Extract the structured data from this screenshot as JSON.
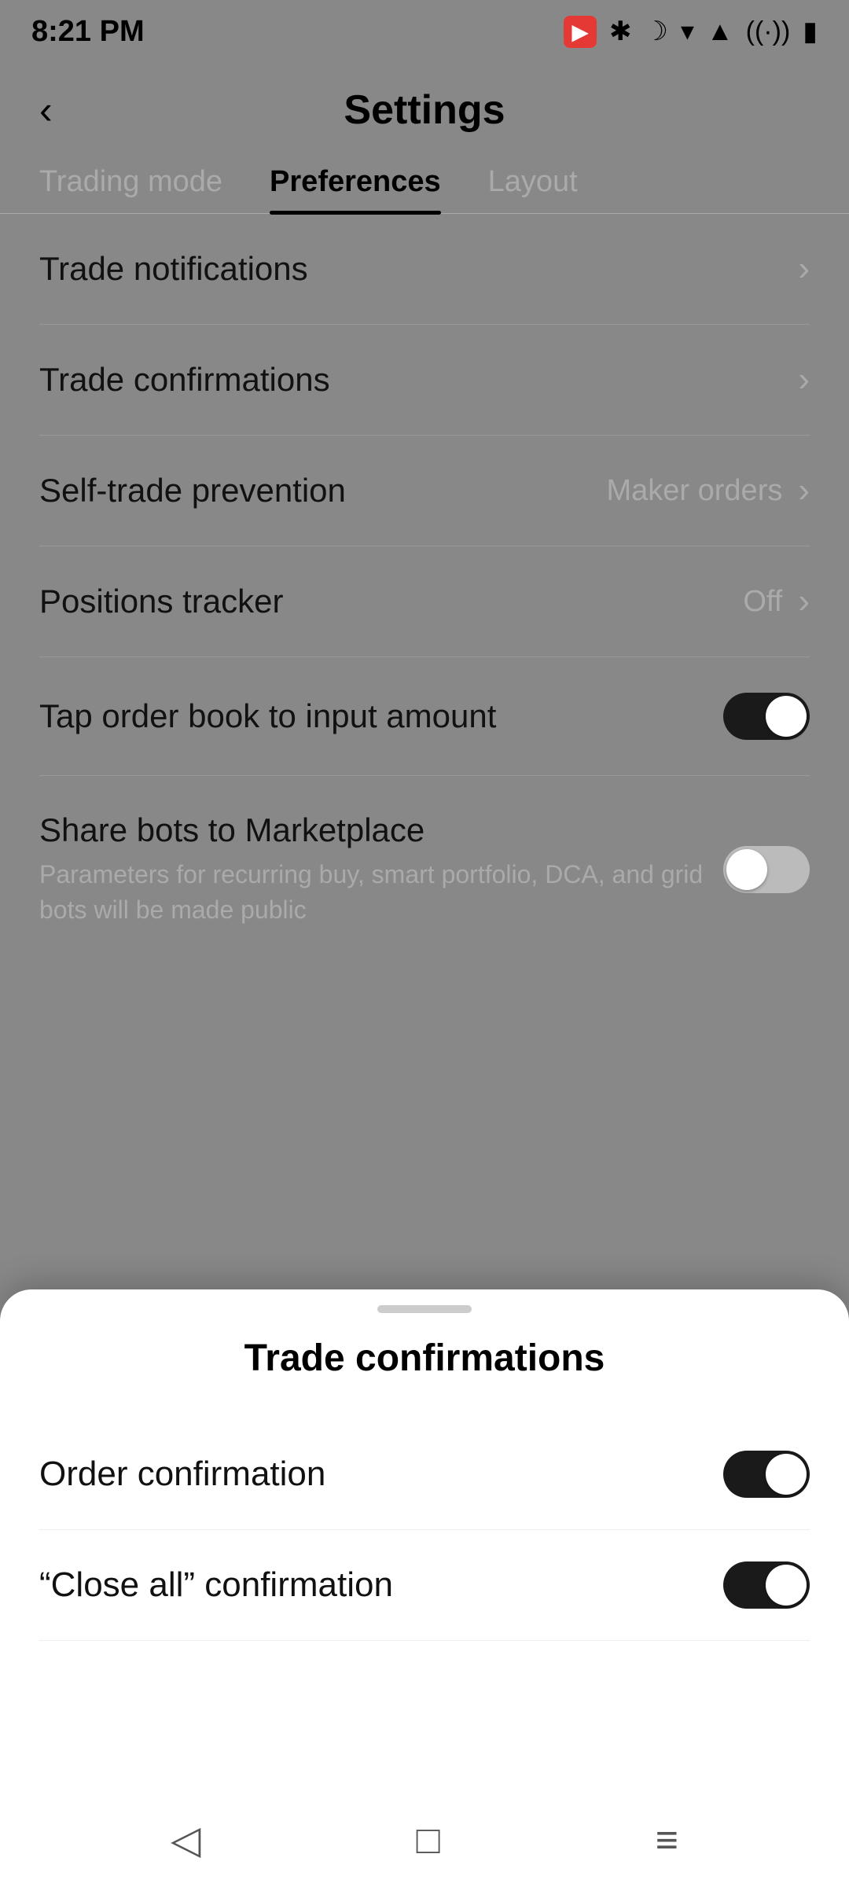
{
  "statusBar": {
    "time": "8:21 PM",
    "cameraIcon": "📷",
    "bluetoothIcon": "✱",
    "moonIcon": "☽",
    "wifiIcon": "WiFi",
    "batteryIcon": "🔋"
  },
  "header": {
    "backLabel": "‹",
    "title": "Settings"
  },
  "tabs": [
    {
      "id": "trading-mode",
      "label": "Trading mode",
      "active": false
    },
    {
      "id": "preferences",
      "label": "Preferences",
      "active": true
    },
    {
      "id": "layout",
      "label": "Layout",
      "active": false
    }
  ],
  "settingsItems": [
    {
      "id": "trade-notifications",
      "label": "Trade notifications",
      "value": "",
      "hasChevron": true,
      "hasToggle": false
    },
    {
      "id": "trade-confirmations",
      "label": "Trade confirmations",
      "value": "",
      "hasChevron": true,
      "hasToggle": false
    },
    {
      "id": "self-trade-prevention",
      "label": "Self-trade prevention",
      "value": "Maker orders",
      "hasChevron": true,
      "hasToggle": false
    },
    {
      "id": "positions-tracker",
      "label": "Positions tracker",
      "value": "Off",
      "hasChevron": true,
      "hasToggle": false
    },
    {
      "id": "tap-order-book",
      "label": "Tap order book to input amount",
      "value": "",
      "hasChevron": false,
      "hasToggle": true,
      "toggleOn": true
    },
    {
      "id": "share-bots",
      "label": "Share bots to Marketplace",
      "sublabel": "Parameters for recurring buy, smart portfolio, DCA, and grid bots will be made public",
      "value": "",
      "hasChevron": false,
      "hasToggle": true,
      "toggleOn": false
    }
  ],
  "bottomSheet": {
    "title": "Trade confirmations",
    "items": [
      {
        "id": "order-confirmation",
        "label": "Order confirmation",
        "toggleOn": true
      },
      {
        "id": "close-all-confirmation",
        "label": "“Close all” confirmation",
        "toggleOn": true
      }
    ],
    "dragHandle": true
  },
  "navBar": {
    "backBtn": "◁",
    "homeBtn": "□",
    "menuBtn": "≡"
  }
}
